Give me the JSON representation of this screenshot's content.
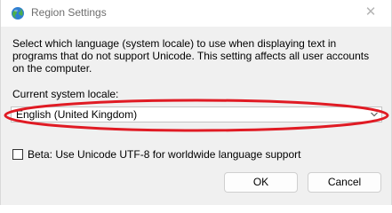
{
  "window": {
    "title": "Region Settings",
    "close_glyph": "✕"
  },
  "description": "Select which language (system locale) to use when displaying text in programs that do not support Unicode. This setting affects all user accounts on the computer.",
  "locale": {
    "label": "Current system locale:",
    "selected": "English (United Kingdom)",
    "chevron_icon": "chevron-down-icon"
  },
  "beta_option": {
    "label": "Beta: Use Unicode UTF-8 for worldwide language support",
    "checked": false
  },
  "buttons": {
    "ok": "OK",
    "cancel": "Cancel"
  },
  "annotation": {
    "color": "#e01b24"
  },
  "icons": {
    "title": "globe-icon",
    "close": "close-icon"
  }
}
